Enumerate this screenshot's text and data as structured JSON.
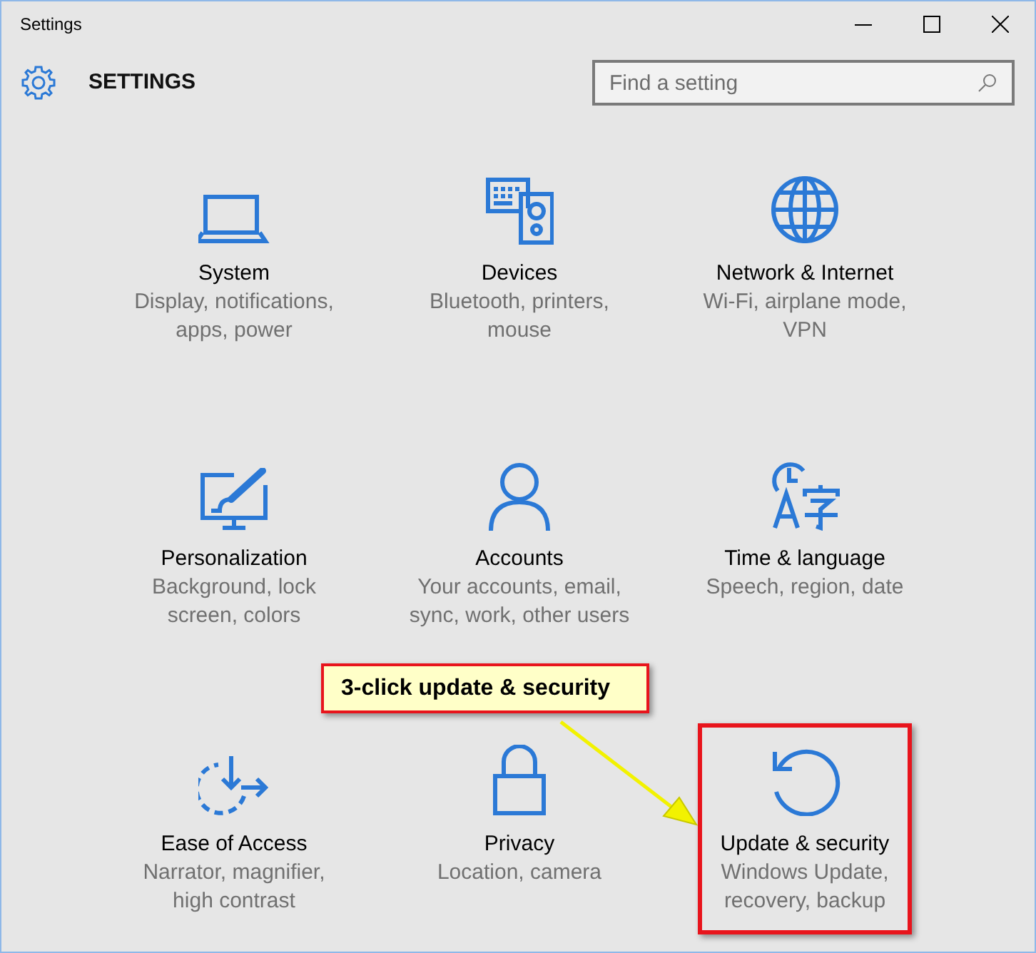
{
  "window": {
    "title": "Settings"
  },
  "header": {
    "title": "SETTINGS"
  },
  "search": {
    "placeholder": "Find a setting"
  },
  "tiles": [
    {
      "kind": "laptop",
      "title": "System",
      "description_lines": [
        "Display, notifications,",
        "apps, power"
      ],
      "highlighted": false
    },
    {
      "kind": "devices",
      "title": "Devices",
      "description_lines": [
        "Bluetooth, printers,",
        "mouse"
      ],
      "highlighted": false
    },
    {
      "kind": "globe",
      "title": "Network & Internet",
      "description_lines": [
        "Wi-Fi, airplane mode,",
        "VPN"
      ],
      "highlighted": false
    },
    {
      "kind": "brush",
      "title": "Personalization",
      "description_lines": [
        "Background, lock",
        "screen, colors"
      ],
      "highlighted": false
    },
    {
      "kind": "person",
      "title": "Accounts",
      "description_lines": [
        "Your accounts, email,",
        "sync, work, other users"
      ],
      "highlighted": false
    },
    {
      "kind": "clock-language",
      "title": "Time & language",
      "description_lines": [
        "Speech, region, date"
      ],
      "highlighted": false
    },
    {
      "kind": "ease",
      "title": "Ease of Access",
      "description_lines": [
        "Narrator, magnifier,",
        "high contrast"
      ],
      "highlighted": false
    },
    {
      "kind": "lock",
      "title": "Privacy",
      "description_lines": [
        "Location, camera"
      ],
      "highlighted": false
    },
    {
      "kind": "refresh",
      "title": "Update & security",
      "description_lines": [
        "Windows Update,",
        "recovery, backup"
      ],
      "highlighted": true
    }
  ],
  "callout": {
    "text": "3-click update & security"
  }
}
